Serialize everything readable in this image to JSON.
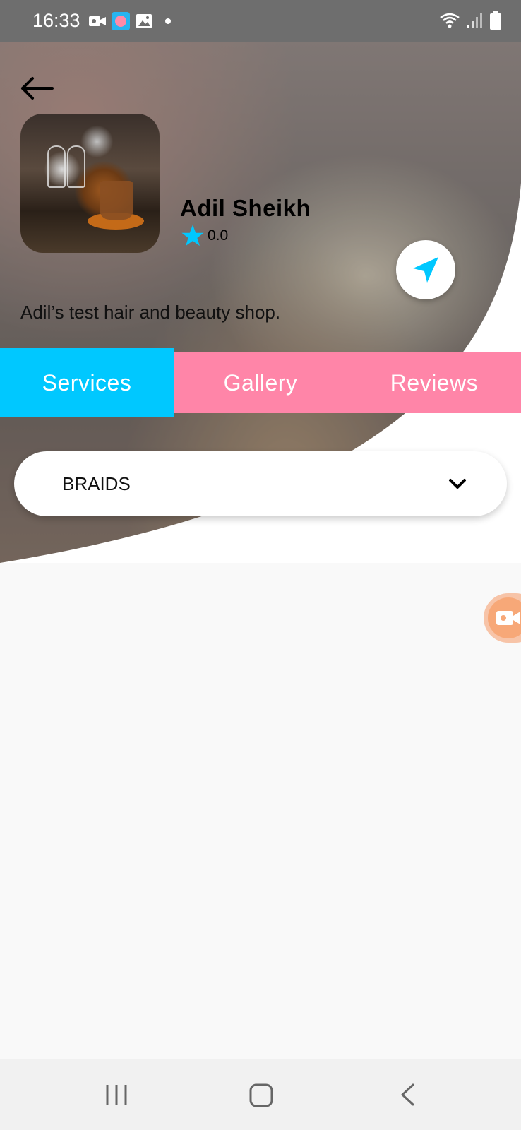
{
  "status_bar": {
    "time": "16:33"
  },
  "shop": {
    "name": "Adil Sheikh",
    "rating": "0.0",
    "description": "Adil’s test hair and beauty shop."
  },
  "tabs": [
    {
      "label": "Services",
      "active": true,
      "color": "#00c8ff"
    },
    {
      "label": "Gallery",
      "active": false,
      "color": "#ff85a8"
    },
    {
      "label": "Reviews",
      "active": false,
      "color": "#ff85a8"
    }
  ],
  "dropdown": {
    "selected": "BRAIDS"
  },
  "colors": {
    "accent_blue": "#00c8ff",
    "accent_pink": "#ff85a8",
    "fab_orange": "#f7a878"
  },
  "icons": {
    "back": "back-arrow-icon",
    "star": "star-icon",
    "navigate": "navigation-arrow-icon",
    "chevron": "chevron-down-icon",
    "video": "video-camera-icon"
  }
}
